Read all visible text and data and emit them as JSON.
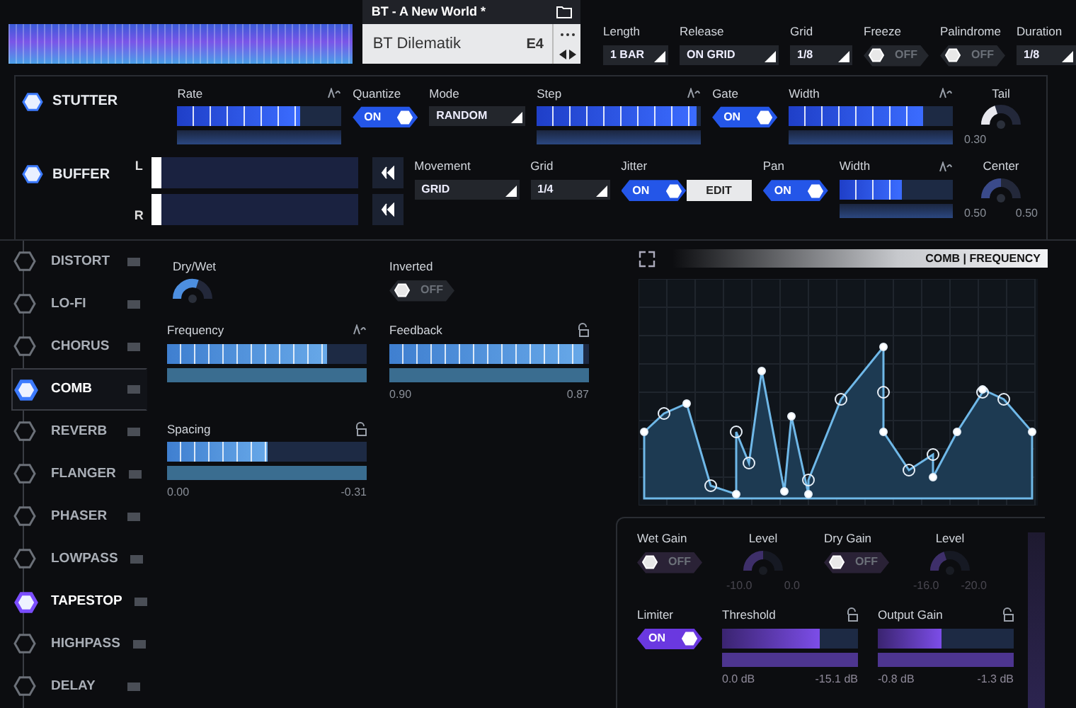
{
  "preset": {
    "title": "BT - A New World *",
    "name": "BT Dilematik",
    "key": "E4"
  },
  "global_params": [
    {
      "kind": "select",
      "label": "Length",
      "value": "1 BAR"
    },
    {
      "kind": "select",
      "label": "Release",
      "value": "ON GRID"
    },
    {
      "kind": "select",
      "label": "Grid",
      "value": "1/8"
    },
    {
      "kind": "toggle",
      "label": "Freeze",
      "on": false,
      "text": "OFF"
    },
    {
      "kind": "toggle",
      "label": "Palindrome",
      "on": false,
      "text": "OFF"
    },
    {
      "kind": "select",
      "label": "Duration",
      "value": "1/8"
    }
  ],
  "stutter": {
    "label": "STUTTER",
    "on": true,
    "controls": [
      {
        "kind": "slider",
        "label": "Rate",
        "level": 0.75
      },
      {
        "kind": "toggle",
        "label": "Quantize",
        "on": true,
        "text": "ON"
      },
      {
        "kind": "select",
        "label": "Mode",
        "value": "RANDOM"
      },
      {
        "kind": "slider",
        "label": "Step",
        "level": 0.97
      },
      {
        "kind": "toggle",
        "label": "Gate",
        "on": true,
        "text": "ON"
      },
      {
        "kind": "slider",
        "label": "Width",
        "level": 0.82
      },
      {
        "kind": "knob",
        "label": "Tail",
        "level": 0.4,
        "readings": [
          "0.30"
        ]
      }
    ]
  },
  "buffer": {
    "label": "BUFFER",
    "on": true,
    "channels": [
      "L",
      "R"
    ],
    "controls": [
      {
        "kind": "select",
        "label": "Movement",
        "value": "GRID"
      },
      {
        "kind": "select",
        "label": "Grid",
        "value": "1/4"
      },
      {
        "kind": "toggle",
        "label": "Jitter",
        "on": true,
        "text": "ON",
        "button": "EDIT"
      },
      {
        "kind": "toggle",
        "label": "Pan",
        "on": true,
        "text": "ON"
      },
      {
        "kind": "slider",
        "label": "Width",
        "level": 0.55
      },
      {
        "kind": "knob",
        "label": "Center",
        "level": 0.5,
        "readings": [
          "0.50",
          "0.50"
        ]
      }
    ]
  },
  "effects": [
    {
      "label": "DISTORT",
      "on": false,
      "selected": false,
      "color": "#6b7078"
    },
    {
      "label": "LO-FI",
      "on": false,
      "selected": false,
      "color": "#6b7078"
    },
    {
      "label": "CHORUS",
      "on": false,
      "selected": false,
      "color": "#6b7078"
    },
    {
      "label": "COMB",
      "on": true,
      "selected": true,
      "color": "#3d7bff"
    },
    {
      "label": "REVERB",
      "on": false,
      "selected": false,
      "color": "#6b7078"
    },
    {
      "label": "FLANGER",
      "on": false,
      "selected": false,
      "color": "#6b7078"
    },
    {
      "label": "PHASER",
      "on": false,
      "selected": false,
      "color": "#6b7078"
    },
    {
      "label": "LOWPASS",
      "on": false,
      "selected": false,
      "color": "#6b7078"
    },
    {
      "label": "TAPESTOP",
      "on": true,
      "selected": false,
      "color": "#7b4dff"
    },
    {
      "label": "HIGHPASS",
      "on": false,
      "selected": false,
      "color": "#6b7078"
    },
    {
      "label": "DELAY",
      "on": false,
      "selected": false,
      "color": "#6b7078"
    }
  ],
  "comb": {
    "controls": [
      {
        "kind": "knob",
        "label": "Dry/Wet",
        "level": 0.6
      },
      {
        "kind": "toggle",
        "label": "Inverted",
        "on": false,
        "text": "OFF"
      },
      {
        "kind": "slider",
        "label": "Frequency",
        "level": 0.8
      },
      {
        "kind": "slider",
        "label": "Feedback",
        "level": 0.97,
        "readings": [
          "0.90",
          "0.87"
        ]
      },
      {
        "kind": "slider",
        "label": "Spacing",
        "level": 0.5,
        "readings": [
          "0.00",
          "-0.31"
        ]
      }
    ]
  },
  "graph": {
    "title": "COMB | FREQUENCY"
  },
  "gain": {
    "upper": [
      {
        "kind": "toggle",
        "label": "Wet Gain",
        "on": false,
        "text": "OFF"
      },
      {
        "kind": "knob",
        "label": "Level",
        "level": 0.5,
        "disabled": true,
        "readings": [
          "-10.0",
          "0.0"
        ]
      },
      {
        "kind": "toggle",
        "label": "Dry Gain",
        "on": false,
        "text": "OFF"
      },
      {
        "kind": "knob",
        "label": "Level",
        "level": 0.4,
        "disabled": true,
        "readings": [
          "-16.0",
          "-20.0"
        ]
      }
    ],
    "lower": [
      {
        "kind": "toggle",
        "label": "Limiter",
        "on": true,
        "text": "ON"
      },
      {
        "kind": "slider",
        "label": "Threshold",
        "level": 0.72,
        "readings": [
          "0.0 dB",
          "-15.1 dB"
        ]
      },
      {
        "kind": "slider",
        "label": "Output Gain",
        "level": 0.47,
        "readings": [
          "-0.8 dB",
          "-1.3 dB"
        ]
      }
    ]
  }
}
